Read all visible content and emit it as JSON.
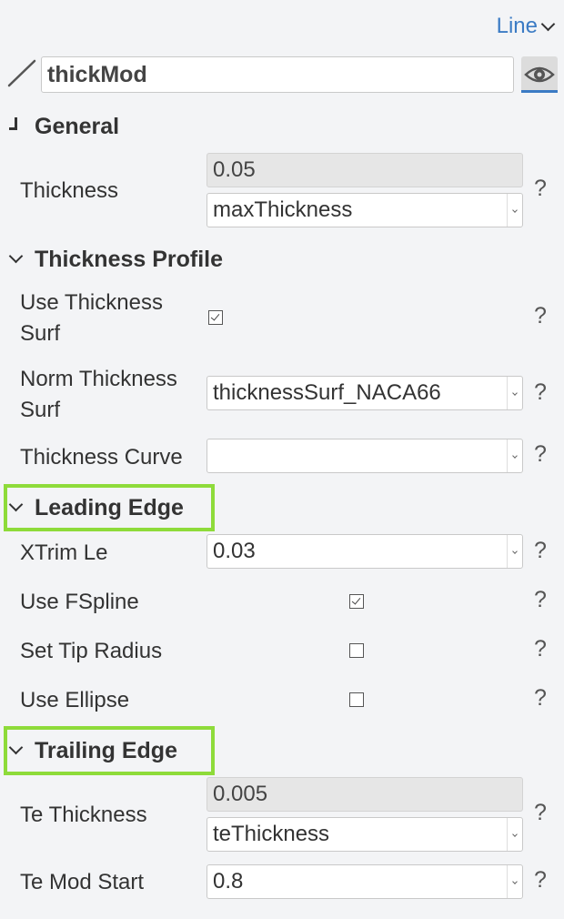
{
  "header": {
    "type_label": "Line",
    "name_value": "thickMod"
  },
  "sections": {
    "general": "General",
    "thickness_profile": "Thickness Profile",
    "leading_edge": "Leading Edge",
    "trailing_edge": "Trailing Edge"
  },
  "properties": {
    "thickness": {
      "label": "Thickness",
      "value": "0.05",
      "param": "maxThickness"
    },
    "use_thickness_surf": {
      "label": "Use Thickness Surf",
      "checked": true
    },
    "norm_thickness_surf": {
      "label": "Norm Thickness Surf",
      "value": "thicknessSurf_NACA66"
    },
    "thickness_curve": {
      "label": "Thickness Curve",
      "value": ""
    },
    "xtrim_le": {
      "label": "XTrim Le",
      "value": "0.03"
    },
    "use_fspline": {
      "label": "Use FSpline",
      "checked": true
    },
    "set_tip_radius": {
      "label": "Set Tip Radius",
      "checked": false
    },
    "use_ellipse": {
      "label": "Use Ellipse",
      "checked": false
    },
    "te_thickness": {
      "label": "Te Thickness",
      "value": "0.005",
      "param": "teThickness"
    },
    "te_mod_start": {
      "label": "Te Mod Start",
      "value": "0.8"
    }
  },
  "help_glyph": "?",
  "colors": {
    "accent": "#3b7bc4",
    "highlight": "#8edb3a",
    "background": "#f3f4f6"
  }
}
